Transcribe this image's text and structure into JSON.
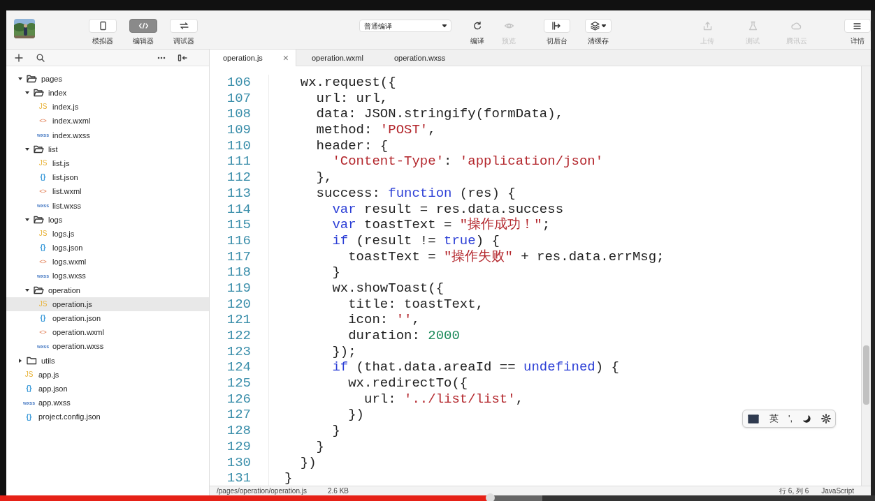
{
  "toolbar": {
    "view_buttons": [
      {
        "label": "模拟器",
        "selected": false
      },
      {
        "label": "编辑器",
        "selected": true
      },
      {
        "label": "调试器",
        "selected": false
      }
    ],
    "compile_mode": {
      "value": "普通编译"
    },
    "actions": [
      {
        "label": "编译",
        "disabled": false
      },
      {
        "label": "预览",
        "disabled": true
      },
      {
        "label": "切后台",
        "disabled": false
      },
      {
        "label": "清缓存",
        "disabled": false
      },
      {
        "label": "上传",
        "disabled": true
      },
      {
        "label": "测试",
        "disabled": true
      },
      {
        "label": "腾讯云",
        "disabled": true
      },
      {
        "label": "详情",
        "disabled": false
      }
    ]
  },
  "sidebar": {
    "tree": [
      {
        "label": "pages",
        "expanded": true,
        "children": [
          {
            "label": "index",
            "expanded": true,
            "children": [
              {
                "label": "index.js",
                "kind": "js",
                "badge": "JS",
                "selected": false
              },
              {
                "label": "index.wxml",
                "kind": "wxml",
                "badge": "<>",
                "selected": false
              },
              {
                "label": "index.wxss",
                "kind": "wxss",
                "badge": "wxss",
                "selected": false
              }
            ]
          },
          {
            "label": "list",
            "expanded": true,
            "children": [
              {
                "label": "list.js",
                "kind": "js",
                "badge": "JS",
                "selected": false
              },
              {
                "label": "list.json",
                "kind": "json",
                "badge": "{}",
                "selected": false
              },
              {
                "label": "list.wxml",
                "kind": "wxml",
                "badge": "<>",
                "selected": false
              },
              {
                "label": "list.wxss",
                "kind": "wxss",
                "badge": "wxss",
                "selected": false
              }
            ]
          },
          {
            "label": "logs",
            "expanded": true,
            "children": [
              {
                "label": "logs.js",
                "kind": "js",
                "badge": "JS",
                "selected": false
              },
              {
                "label": "logs.json",
                "kind": "json",
                "badge": "{}",
                "selected": false
              },
              {
                "label": "logs.wxml",
                "kind": "wxml",
                "badge": "<>",
                "selected": false
              },
              {
                "label": "logs.wxss",
                "kind": "wxss",
                "badge": "wxss",
                "selected": false
              }
            ]
          },
          {
            "label": "operation",
            "expanded": true,
            "children": [
              {
                "label": "operation.js",
                "kind": "js",
                "badge": "JS",
                "selected": true
              },
              {
                "label": "operation.json",
                "kind": "json",
                "badge": "{}",
                "selected": false
              },
              {
                "label": "operation.wxml",
                "kind": "wxml",
                "badge": "<>",
                "selected": false
              },
              {
                "label": "operation.wxss",
                "kind": "wxss",
                "badge": "wxss",
                "selected": false
              }
            ]
          }
        ]
      },
      {
        "label": "utils",
        "expanded": false
      },
      {
        "label": "app.js",
        "kind": "js",
        "badge": "JS",
        "selected": false
      },
      {
        "label": "app.json",
        "kind": "json",
        "badge": "{}",
        "selected": false
      },
      {
        "label": "app.wxss",
        "kind": "wxss",
        "badge": "wxss",
        "selected": false
      },
      {
        "label": "project.config.json",
        "kind": "json",
        "badge": "{}",
        "selected": false
      }
    ]
  },
  "tabs": [
    {
      "label": "operation.js",
      "selected": true,
      "close": "×"
    },
    {
      "label": "operation.wxml",
      "selected": false
    },
    {
      "label": "operation.wxss",
      "selected": false
    }
  ],
  "editor": {
    "lines": [
      {
        "number": "106",
        "tokens": [
          {
            "kind": "plain",
            "text": "  wx.request({"
          }
        ]
      },
      {
        "number": "107",
        "tokens": [
          {
            "kind": "plain",
            "text": "    url: url,"
          }
        ]
      },
      {
        "number": "108",
        "tokens": [
          {
            "kind": "plain",
            "text": "    data: JSON.stringify(formData),"
          }
        ]
      },
      {
        "number": "109",
        "tokens": [
          {
            "kind": "plain",
            "text": "    method: "
          },
          {
            "kind": "string",
            "text": "'POST'"
          },
          {
            "kind": "plain",
            "text": ","
          }
        ]
      },
      {
        "number": "110",
        "tokens": [
          {
            "kind": "plain",
            "text": "    header: {"
          }
        ]
      },
      {
        "number": "111",
        "tokens": [
          {
            "kind": "string",
            "text": "      'Content-Type'"
          },
          {
            "kind": "plain",
            "text": ": "
          },
          {
            "kind": "string",
            "text": "'application/json'"
          }
        ]
      },
      {
        "number": "112",
        "tokens": [
          {
            "kind": "plain",
            "text": "    },"
          }
        ]
      },
      {
        "number": "113",
        "tokens": [
          {
            "kind": "plain",
            "text": "    success: "
          },
          {
            "kind": "keyword",
            "text": "function"
          },
          {
            "kind": "plain",
            "text": " (res) {"
          }
        ]
      },
      {
        "number": "114",
        "tokens": [
          {
            "kind": "keyword",
            "text": "      var"
          },
          {
            "kind": "plain",
            "text": " result = res.data.success"
          }
        ]
      },
      {
        "number": "115",
        "tokens": [
          {
            "kind": "keyword",
            "text": "      var"
          },
          {
            "kind": "plain",
            "text": " toastText = "
          },
          {
            "kind": "string",
            "text": "\"操作成功！\""
          },
          {
            "kind": "plain",
            "text": ";"
          }
        ]
      },
      {
        "number": "116",
        "tokens": [
          {
            "kind": "keyword",
            "text": "      if"
          },
          {
            "kind": "plain",
            "text": " (result != "
          },
          {
            "kind": "keyword",
            "text": "true"
          },
          {
            "kind": "plain",
            "text": ") {"
          }
        ]
      },
      {
        "number": "117",
        "tokens": [
          {
            "kind": "plain",
            "text": "        toastText = "
          },
          {
            "kind": "string",
            "text": "\"操作失败\""
          },
          {
            "kind": "plain",
            "text": " + res.data.errMsg;"
          }
        ]
      },
      {
        "number": "118",
        "tokens": [
          {
            "kind": "plain",
            "text": "      }"
          }
        ]
      },
      {
        "number": "119",
        "tokens": [
          {
            "kind": "plain",
            "text": "      wx.showToast({"
          }
        ]
      },
      {
        "number": "120",
        "tokens": [
          {
            "kind": "plain",
            "text": "        title: toastText,"
          }
        ]
      },
      {
        "number": "121",
        "tokens": [
          {
            "kind": "plain",
            "text": "        icon: "
          },
          {
            "kind": "string",
            "text": "''"
          },
          {
            "kind": "plain",
            "text": ","
          }
        ]
      },
      {
        "number": "122",
        "tokens": [
          {
            "kind": "plain",
            "text": "        duration: "
          },
          {
            "kind": "number",
            "text": "2000"
          }
        ]
      },
      {
        "number": "123",
        "tokens": [
          {
            "kind": "plain",
            "text": "      });"
          }
        ]
      },
      {
        "number": "124",
        "tokens": [
          {
            "kind": "keyword",
            "text": "      if"
          },
          {
            "kind": "plain",
            "text": " (that.data.areaId == "
          },
          {
            "kind": "keyword",
            "text": "undefined"
          },
          {
            "kind": "plain",
            "text": ") {"
          }
        ]
      },
      {
        "number": "125",
        "tokens": [
          {
            "kind": "plain",
            "text": "        wx.redirectTo({"
          }
        ]
      },
      {
        "number": "126",
        "tokens": [
          {
            "kind": "plain",
            "text": "          url: "
          },
          {
            "kind": "string",
            "text": "'../list/list'"
          },
          {
            "kind": "plain",
            "text": ","
          }
        ]
      },
      {
        "number": "127",
        "tokens": [
          {
            "kind": "plain",
            "text": "        })"
          }
        ]
      },
      {
        "number": "128",
        "tokens": [
          {
            "kind": "plain",
            "text": "      }"
          }
        ]
      },
      {
        "number": "129",
        "tokens": [
          {
            "kind": "plain",
            "text": "    }"
          }
        ]
      },
      {
        "number": "130",
        "tokens": [
          {
            "kind": "plain",
            "text": "  })"
          }
        ]
      },
      {
        "number": "131",
        "tokens": [
          {
            "kind": "plain",
            "text": "}"
          }
        ]
      }
    ]
  },
  "ime_toolbar": {
    "items": [
      "英",
      "',"
    ]
  },
  "status_bar": {
    "path": "/pages/operation/operation.js",
    "size": "2.6 KB",
    "cursor": "行 6, 列 6",
    "language": "JavaScript"
  },
  "video_progress": {
    "level": 0.56
  }
}
